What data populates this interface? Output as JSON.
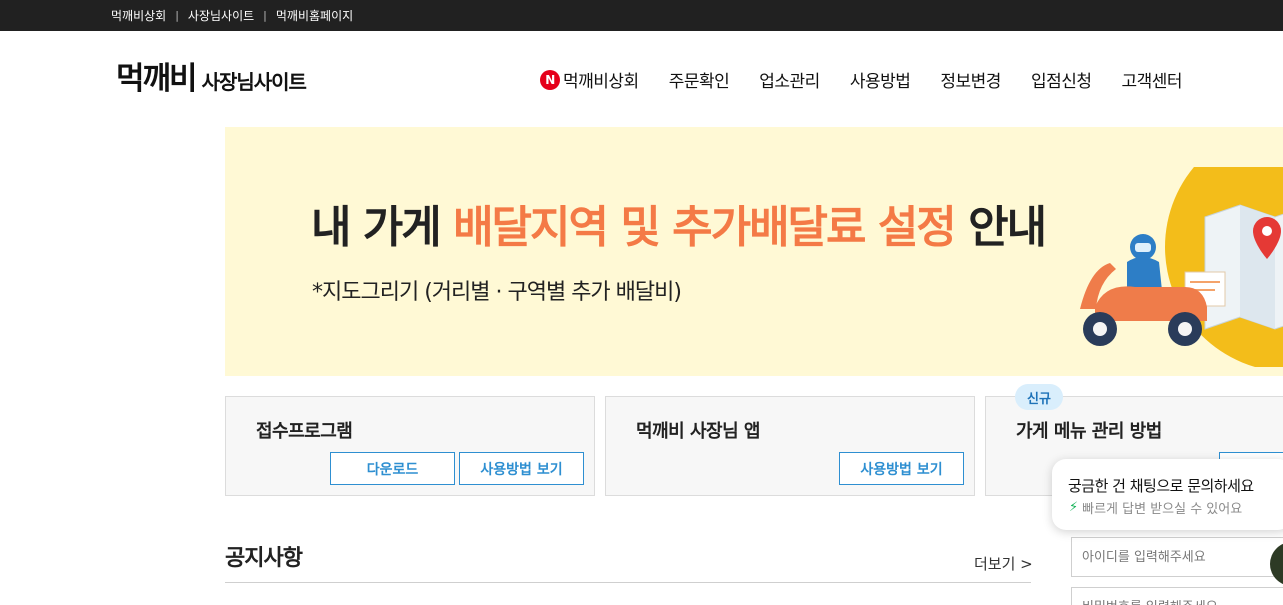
{
  "topbar": {
    "links": [
      "먹깨비상회",
      "사장님사이트",
      "먹깨비홈페이지"
    ]
  },
  "header": {
    "logo": "먹깨비",
    "logo_sub": "사장님사이트",
    "nav": [
      {
        "label": "먹깨비상회",
        "badge": "N"
      },
      {
        "label": "주문확인"
      },
      {
        "label": "업소관리"
      },
      {
        "label": "사용방법"
      },
      {
        "label": "정보변경"
      },
      {
        "label": "입점신청"
      },
      {
        "label": "고객센터"
      }
    ]
  },
  "banner": {
    "title_prefix": "내 가게 ",
    "title_accent": "배달지역 및 추가배달료 설정",
    "title_suffix": " 안내",
    "subtitle": "*지도그리기 (거리별 · 구역별 추가 배달비)",
    "bg_color": "#fff9d5",
    "accent_color": "#f47a46"
  },
  "cards": [
    {
      "title": "접수프로그램",
      "buttons": [
        "다운로드",
        "사용방법 보기"
      ]
    },
    {
      "title": "먹깨비 사장님 앱",
      "buttons": [
        "사용방법 보기"
      ]
    },
    {
      "title": "가게 메뉴 관리 방법",
      "badge": "신규",
      "buttons": [
        ""
      ]
    }
  ],
  "notice": {
    "title": "공지사항",
    "more": "더보기 >"
  },
  "chat": {
    "question": "궁금한 건 채팅으로 문의하세요",
    "answer": "빠르게 답변 받으실 수 있어요",
    "icon": "bolt-icon"
  },
  "login": {
    "id_placeholder": "아이디를 입력해주세요",
    "pw_placeholder": "비밀번호를 입력해주세요"
  },
  "colors": {
    "topbar": "#212121",
    "button_blue": "#2e8fd1",
    "badge_red": "#e5001a"
  }
}
